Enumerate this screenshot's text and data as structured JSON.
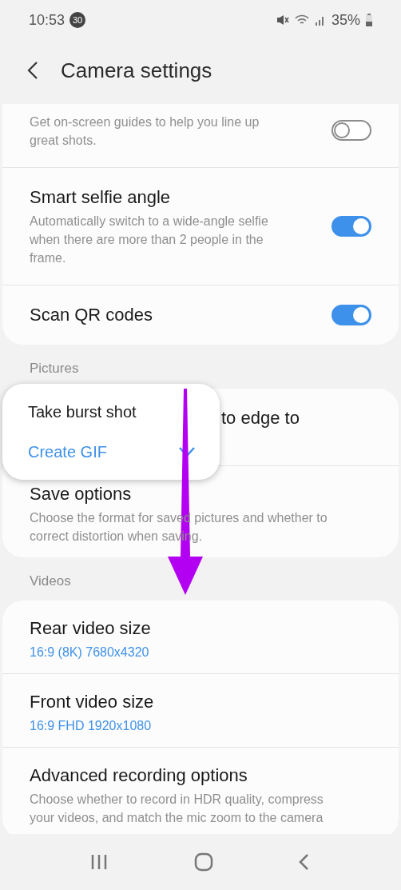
{
  "status_bar": {
    "time": "10:53",
    "notification_count": "30",
    "battery": "35%"
  },
  "header": {
    "title": "Camera settings"
  },
  "sections": [
    {
      "rows": [
        {
          "kind": "toggle",
          "title": null,
          "description": "Get on-screen guides to help you line up great shots.",
          "on": false
        },
        {
          "kind": "toggle",
          "title": "Smart selfie angle",
          "description": "Automatically switch to a wide-angle selfie when there are more than 2 people in the frame.",
          "on": true
        },
        {
          "kind": "toggle",
          "title": "Scan QR codes",
          "on": true
        }
      ]
    },
    {
      "label": "Pictures",
      "rows": [
        {
          "kind": "partial",
          "title": "to edge to"
        },
        {
          "kind": "plain",
          "title": "Save options",
          "description": "Choose the format for saved pictures and whether to correct distortion when saving."
        }
      ]
    },
    {
      "label": "Videos",
      "rows": [
        {
          "kind": "value",
          "title": "Rear video size",
          "value": "16:9 (8K) 7680x4320"
        },
        {
          "kind": "value",
          "title": "Front video size",
          "value": "16:9 FHD 1920x1080"
        },
        {
          "kind": "plain",
          "title": "Advanced recording options",
          "description": "Choose whether to record in HDR quality, compress your videos, and match the mic zoom to the camera"
        }
      ]
    }
  ],
  "popup_menu": [
    {
      "label": "Take burst shot",
      "selected": false
    },
    {
      "label": "Create GIF",
      "selected": true
    }
  ]
}
